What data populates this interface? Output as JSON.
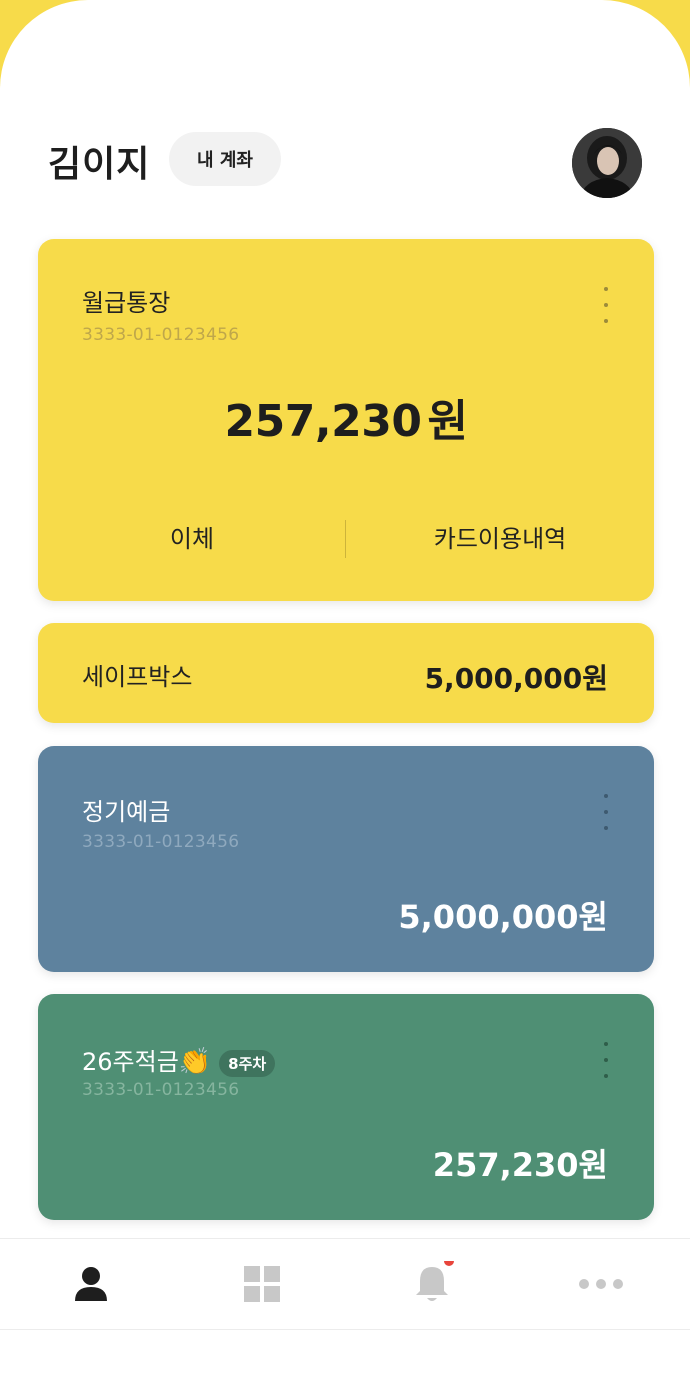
{
  "header": {
    "user_name": "김이지",
    "account_button": "내 계좌",
    "avatar_icon": "profile-photo"
  },
  "accounts": [
    {
      "title": "월급통장",
      "account_number": "3333-01-0123456",
      "balance": "257,230",
      "currency": "원",
      "actions": [
        "이체",
        "카드이용내역"
      ],
      "color": "#F7DB4A"
    },
    {
      "title": "세이프박스",
      "balance": "5,000,000원",
      "color": "#F7DB4A"
    },
    {
      "title": "정기예금",
      "account_number": "3333-01-0123456",
      "balance": "5,000,000원",
      "color": "#5E829E"
    },
    {
      "title": "26주적금",
      "title_emoji": "👏",
      "badge": "8주차",
      "account_number": "3333-01-0123456",
      "balance": "257,230원",
      "color": "#4F8F74"
    }
  ],
  "bottom_nav": [
    {
      "icon": "person-icon",
      "active": true
    },
    {
      "icon": "grid-icon",
      "active": false
    },
    {
      "icon": "bell-icon",
      "active": false,
      "has_notification": true
    },
    {
      "icon": "more-icon",
      "active": false
    }
  ],
  "colors": {
    "accent_yellow": "#F7DB4A",
    "deposit_blue": "#5E829E",
    "savings_green": "#4F8F74",
    "notification_dot": "#E8453C"
  }
}
